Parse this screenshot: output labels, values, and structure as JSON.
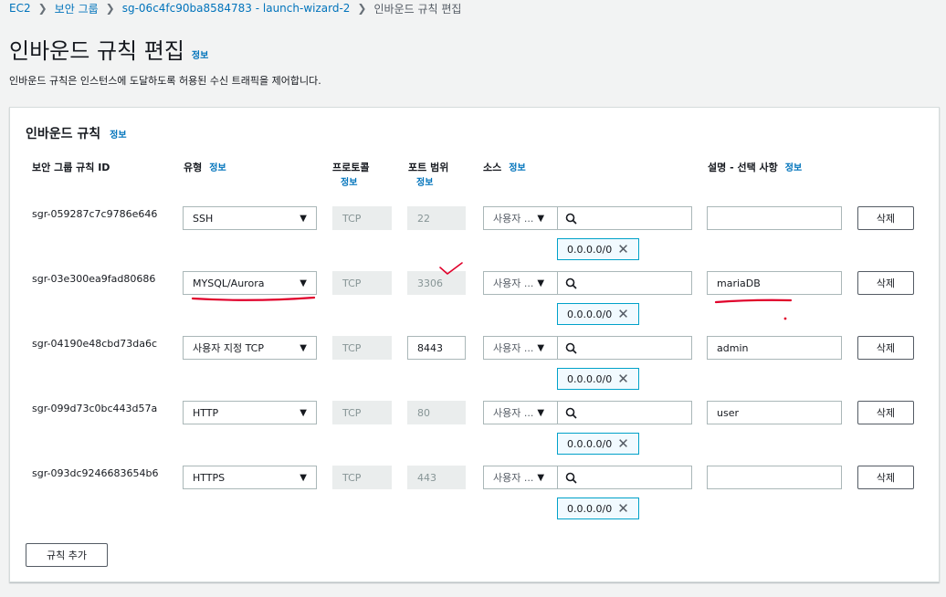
{
  "breadcrumb": {
    "items": [
      "EC2",
      "보안 그룹",
      "sg-06c4fc90ba8584783 - launch-wizard-2"
    ],
    "current": "인바운드 규칙 편집"
  },
  "page": {
    "title": "인바운드 규칙 편집",
    "info": "정보",
    "description": "인바운드 규칙은 인스턴스에 도달하도록 허용된 수신 트래픽을 제어합니다."
  },
  "panel": {
    "title": "인바운드 규칙",
    "info": "정보",
    "headers": {
      "rule_id": "보안 그룹 규칙 ID",
      "type": "유형",
      "protocol": "프로토콜",
      "port_range": "포트 범위",
      "source": "소스",
      "description": "설명 - 선택 사항",
      "info": "정보"
    },
    "rules": [
      {
        "id": "sgr-059287c7c9786e646",
        "type": "SSH",
        "protocol": "TCP",
        "port": "22",
        "source": "사용자 ...",
        "cidr": "0.0.0.0/0",
        "description": ""
      },
      {
        "id": "sgr-03e300ea9fad80686",
        "type": "MYSQL/Aurora",
        "protocol": "TCP",
        "port": "3306",
        "source": "사용자 ...",
        "cidr": "0.0.0.0/0",
        "description": "mariaDB"
      },
      {
        "id": "sgr-04190e48cbd73da6c",
        "type": "사용자 지정 TCP",
        "protocol": "TCP",
        "port": "8443",
        "source": "사용자 ...",
        "cidr": "0.0.0.0/0",
        "description": "admin"
      },
      {
        "id": "sgr-099d73c0bc443d57a",
        "type": "HTTP",
        "protocol": "TCP",
        "port": "80",
        "source": "사용자 ...",
        "cidr": "0.0.0.0/0",
        "description": "user"
      },
      {
        "id": "sgr-093dc9246683654b6",
        "type": "HTTPS",
        "protocol": "TCP",
        "port": "443",
        "source": "사용자 ...",
        "cidr": "0.0.0.0/0",
        "description": ""
      }
    ],
    "delete_label": "삭제",
    "add_rule_label": "규칙 추가"
  },
  "colors": {
    "link": "#0073bb",
    "token_border": "#00a1c9",
    "annotation": "#e0002a"
  }
}
